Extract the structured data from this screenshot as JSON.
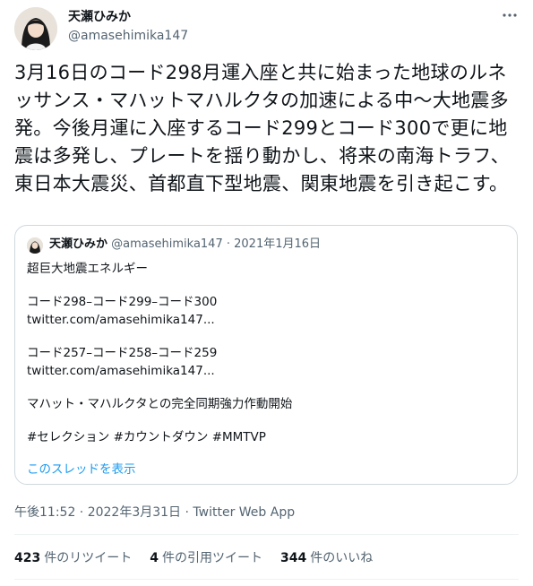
{
  "author": {
    "display_name": "天瀬ひみか",
    "handle": "@amasehimika147"
  },
  "tweet": {
    "text": "3月16日のコード298月運入座と共に始まった地球のルネッサンス・マハットマハルクタの加速による中〜大地震多発。今後月運に入座するコード299とコード300で更に地震は多発し、プレートを揺り動かし、将来の南海トラフ、東日本大震災、首都直下型地震、関東地震を引き起こす。",
    "timestamp": "午後11:52 · 2022年3月31日 · Twitter Web App"
  },
  "quote": {
    "display_name": "天瀬ひみか",
    "meta": "@amasehimika147 · 2021年1月16日",
    "lines": [
      "超巨大地震エネルギー",
      "",
      "コード298–コード299–コード300",
      "twitter.com/amasehimika147...",
      "",
      "コード257–コード258–コード259",
      "twitter.com/amasehimika147...",
      "",
      "マハット・マハルクタとの完全同期強力作動開始",
      "",
      "#セレクション #カウントダウン #MMTVP"
    ],
    "show_thread": "このスレッドを表示"
  },
  "stats": {
    "retweets_count": "423",
    "retweets_label": "件のリツイート",
    "quotes_count": "4",
    "quotes_label": "件の引用ツイート",
    "likes_count": "344",
    "likes_label": "件のいいね"
  },
  "more_icon": "more-horizontal-icon",
  "colors": {
    "text": "#0f1419",
    "secondary": "#536471",
    "link": "#1d9bf0",
    "border": "#cfd9de"
  }
}
